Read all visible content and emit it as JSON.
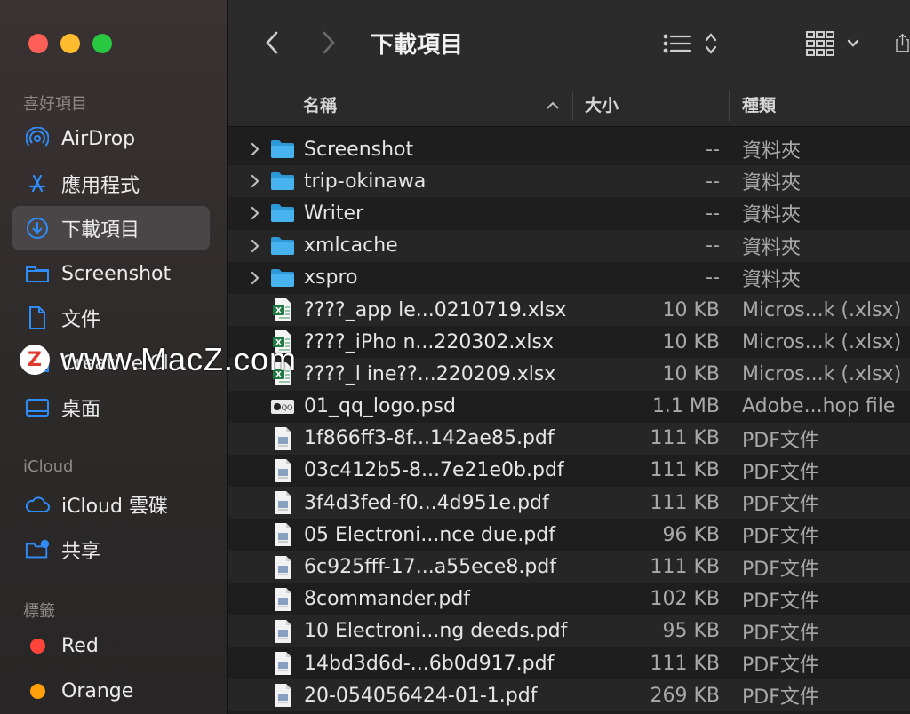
{
  "window": {
    "title": "下載項目",
    "traffic_lights": {
      "close": "#fe5f57",
      "minimize": "#febc2e",
      "zoom": "#28c840"
    }
  },
  "sidebar": {
    "favorites_title": "喜好項目",
    "favorites": [
      {
        "label": "AirDrop",
        "icon": "airdrop-icon"
      },
      {
        "label": "應用程式",
        "icon": "applications-icon"
      },
      {
        "label": "下載項目",
        "icon": "downloads-icon",
        "active": true
      },
      {
        "label": "Screenshot",
        "icon": "folder-icon"
      },
      {
        "label": "文件",
        "icon": "document-icon"
      },
      {
        "label": "Creative Cl...",
        "icon": "folder-icon"
      },
      {
        "label": "桌面",
        "icon": "desktop-icon"
      }
    ],
    "icloud_title": "iCloud",
    "icloud": [
      {
        "label": "iCloud 雲碟",
        "icon": "cloud-icon"
      },
      {
        "label": "共享",
        "icon": "shared-folder-icon"
      }
    ],
    "tags_title": "標籤",
    "tags": [
      {
        "label": "Red",
        "color": "#ff453a"
      },
      {
        "label": "Orange",
        "color": "#ff9f0a"
      }
    ]
  },
  "columns": {
    "name": "名稱",
    "size": "大小",
    "kind": "種類"
  },
  "files": [
    {
      "name": "Screenshot",
      "size": "--",
      "kind": "資料夾",
      "type": "folder"
    },
    {
      "name": "trip-okinawa",
      "size": "--",
      "kind": "資料夾",
      "type": "folder"
    },
    {
      "name": "Writer",
      "size": "--",
      "kind": "資料夾",
      "type": "folder"
    },
    {
      "name": "xmlcache",
      "size": "--",
      "kind": "資料夾",
      "type": "folder"
    },
    {
      "name": "xspro",
      "size": "--",
      "kind": "資料夾",
      "type": "folder"
    },
    {
      "name": "????_app le...0210719.xlsx",
      "size": "10 KB",
      "kind": "Micros...k (.xlsx)",
      "type": "xlsx"
    },
    {
      "name": "????_iPho n...220302.xlsx",
      "size": "10 KB",
      "kind": "Micros...k (.xlsx)",
      "type": "xlsx"
    },
    {
      "name": "????_l ine??...220209.xlsx",
      "size": "10 KB",
      "kind": "Micros...k (.xlsx)",
      "type": "xlsx"
    },
    {
      "name": "01_qq_logo.psd",
      "size": "1.1 MB",
      "kind": "Adobe...hop file",
      "type": "psd"
    },
    {
      "name": "1f866ff3-8f...142ae85.pdf",
      "size": "111 KB",
      "kind": "PDF文件",
      "type": "pdf"
    },
    {
      "name": "03c412b5-8...7e21e0b.pdf",
      "size": "111 KB",
      "kind": "PDF文件",
      "type": "pdf"
    },
    {
      "name": "3f4d3fed-f0...4d951e.pdf",
      "size": "111 KB",
      "kind": "PDF文件",
      "type": "pdf"
    },
    {
      "name": "05 Electroni...nce due.pdf",
      "size": "96 KB",
      "kind": "PDF文件",
      "type": "pdf"
    },
    {
      "name": "6c925fff-17...a55ece8.pdf",
      "size": "111 KB",
      "kind": "PDF文件",
      "type": "pdf"
    },
    {
      "name": "8commander.pdf",
      "size": "102 KB",
      "kind": "PDF文件",
      "type": "pdf"
    },
    {
      "name": "10 Electroni...ng deeds.pdf",
      "size": "95 KB",
      "kind": "PDF文件",
      "type": "pdf"
    },
    {
      "name": "14bd3d6d-...6b0d917.pdf",
      "size": "111 KB",
      "kind": "PDF文件",
      "type": "pdf"
    },
    {
      "name": "20-054056424-01-1.pdf",
      "size": "269 KB",
      "kind": "PDF文件",
      "type": "pdf"
    }
  ],
  "watermark": {
    "logo": "Z",
    "text": "www.MacZ.com"
  },
  "colors": {
    "accent": "#0a84ff",
    "folder": "#35a7e8",
    "xlsx": "#1f7a45"
  }
}
